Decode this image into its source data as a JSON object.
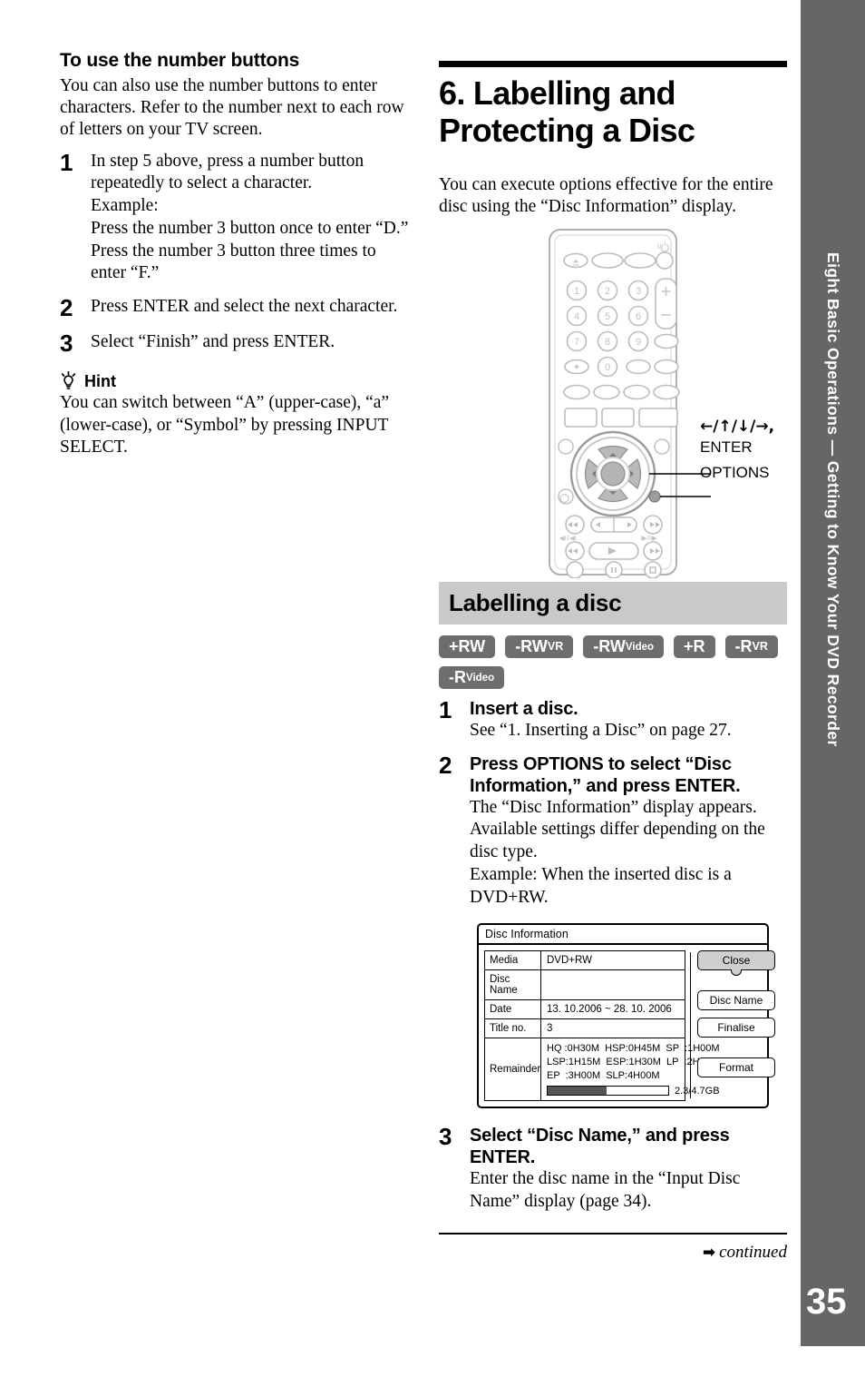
{
  "sidebar": {
    "running_head": "Eight Basic Operations — Getting to Know Your DVD Recorder",
    "page_number": "35",
    "bg_color": "#666666"
  },
  "left_column": {
    "subheading": "To use the number buttons",
    "intro": "You can also use the number buttons to enter characters. Refer to the number next to each row of letters on your TV screen.",
    "steps": [
      {
        "number": "1",
        "lines": [
          "In step 5 above, press a number button repeatedly to select a character.",
          "Example:",
          "Press the number 3 button once to enter “D.”",
          "Press the number 3 button three times to enter “F.”"
        ]
      },
      {
        "number": "2",
        "lines": [
          "Press ENTER and select the next character."
        ]
      },
      {
        "number": "3",
        "lines": [
          "Select “Finish” and press ENTER."
        ]
      }
    ],
    "hint": {
      "icon": "lightbulb-icon",
      "label": "Hint",
      "text": "You can switch between “A” (upper-case), “a” (lower-case), or “Symbol” by pressing INPUT SELECT."
    }
  },
  "right_column": {
    "heading": "6. Labelling and Protecting a Disc",
    "intro": "You can execute options effective for the entire disc using the “Disc Information” display.",
    "remote_callouts": {
      "arrows": "←/↑/↓/→,",
      "enter": "ENTER",
      "options": "OPTIONS"
    },
    "band_title": "Labelling a disc",
    "band_color": "#c9c9c9",
    "badges": [
      {
        "main": "+RW",
        "sub": ""
      },
      {
        "main": "-RW",
        "sub": "VR",
        "sub_size": "caps"
      },
      {
        "main": "-RW",
        "sub": "Video"
      },
      {
        "main": "+R",
        "sub": ""
      },
      {
        "main": "-R",
        "sub": "VR",
        "sub_size": "caps"
      },
      {
        "main": "-R",
        "sub": "Video"
      }
    ],
    "badge_color": "#6e6e6e",
    "steps": [
      {
        "number": "1",
        "bold": [
          "Insert a disc."
        ],
        "lines": [
          "See “1. Inserting a Disc” on page 27."
        ]
      },
      {
        "number": "2",
        "bold": [
          "Press OPTIONS to select “Disc Information,” and press ENTER."
        ],
        "lines": [
          "The “Disc Information” display appears. Available settings differ depending on the disc type.",
          "Example: When the inserted disc is a DVD+RW."
        ]
      },
      {
        "number": "3",
        "bold": [
          "Select “Disc Name,” and press ENTER."
        ],
        "lines": [
          "Enter the disc name in the “Input Disc Name” display (page 34)."
        ]
      }
    ],
    "footer": {
      "arrow": "➡",
      "continued": "continued"
    }
  },
  "disc_information_dialog": {
    "title": "Disc Information",
    "rows": [
      {
        "key": "Media",
        "value": "DVD+RW"
      },
      {
        "key": "Disc Name",
        "value": ""
      },
      {
        "key": "Date",
        "value": "13. 10.2006 ~ 28. 10. 2006"
      },
      {
        "key": "Title no.",
        "value": "3"
      }
    ],
    "remainder": {
      "key": "Remainder",
      "lines": [
        "HQ :0H30M  HSP:0H45M  SP  :1H00M",
        "LSP:1H15M  ESP:1H30M  LP  :2H00M",
        "EP  :3H00M  SLP:4H00M"
      ],
      "meter_percent": 49,
      "meter_label": "2.3/4.7GB"
    },
    "buttons": [
      {
        "label": "Close",
        "selected": true
      },
      {
        "label": "Disc Name",
        "selected": false
      },
      {
        "label": "Finalise",
        "selected": false
      },
      {
        "label": "Format",
        "selected": false
      }
    ]
  }
}
